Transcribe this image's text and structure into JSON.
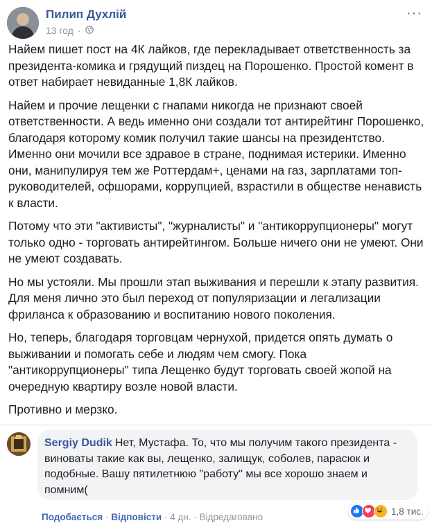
{
  "post": {
    "author": "Пилип Духлій",
    "time": "13 год",
    "paragraphs": [
      "Найем пишет пост на 4К лайков, где перекладывает ответственность за президента-комика и грядущий пиздец на Порошенко. Простой комент в ответ набирает невиданные 1,8К лайков.",
      "Найем и прочие лещенки с гнапами никогда не признают своей ответственности. А ведь именно они создали тот антирейтинг Порошенко, благодаря которому комик получил такие шансы на президентство. Именно они мочили все здравое в стране, поднимая истерики. Именно они, манипулируя тем же Роттердам+, ценами на газ, зарплатами топ-руководителей, офшорами, коррупцией, взрастили в обществе ненависть к власти.",
      "Потому что эти \"активисты\", \"журналисты\" и \"антикоррупционеры\" могут только одно - торговать антирейтингом. Больше ничего они не умеют. Они не умеют создавать.",
      "Но мы устояли. Мы прошли этап выживания и перешли к этапу развития. Для меня лично это был переход от популяризации и легализации фриланса к образованию и воспитанию нового поколения.",
      "Но, теперь, благодаря торговцам чернухой, придется опять думать о выживании и помогать себе и людям чем смогу. Пока \"антикоррупционеры\" типа Лещенко будут торговать своей жопой на очередную квартиру возле новой власти.",
      "Противно и мерзко."
    ]
  },
  "comment": {
    "author": "Sergiy Dudik",
    "text": "Нет, Мустафа. То, что мы получим такого президента - виноваты такие как вы, лещенко, залищук, соболев, парасюк и подобные. Вашу пятилетнюю \"работу\" мы все хорошо знаем и помним(",
    "like_label": "Подобається",
    "reply_label": "Відповісти",
    "time": "4 дн.",
    "edited_label": "Відредаговано",
    "reaction_count": "1,8 тис."
  },
  "colors": {
    "link": "#385898",
    "meta": "#90949c",
    "bubble": "#f2f3f5",
    "like": "#1877f2",
    "love": "#f33e58",
    "haha": "#f7b125"
  },
  "icons": [
    "more-options-icon",
    "globe-icon",
    "like-reaction-icon",
    "love-reaction-icon",
    "haha-reaction-icon"
  ]
}
